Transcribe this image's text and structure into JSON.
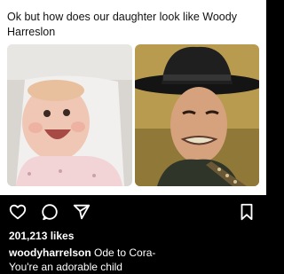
{
  "tweet": {
    "text": "Ok but how does our daughter look like Woody Harreslon",
    "images": [
      {
        "icon": "baby-photo"
      },
      {
        "icon": "man-in-cowboy-hat-photo"
      }
    ]
  },
  "instagram": {
    "actions": [
      {
        "icon": "heart-icon"
      },
      {
        "icon": "comment-icon"
      },
      {
        "icon": "share-icon"
      },
      {
        "icon": "bookmark-icon"
      }
    ],
    "likes": "201,213 likes",
    "caption_user": "woodyharrelson",
    "caption_line1": "Ode to Cora-",
    "caption_line2": "You're an adorable child"
  },
  "colors": {
    "tweet_bg": "#ffffff",
    "instagram_bg": "#000000",
    "text_dark": "#111111",
    "text_light": "#ffffff"
  }
}
